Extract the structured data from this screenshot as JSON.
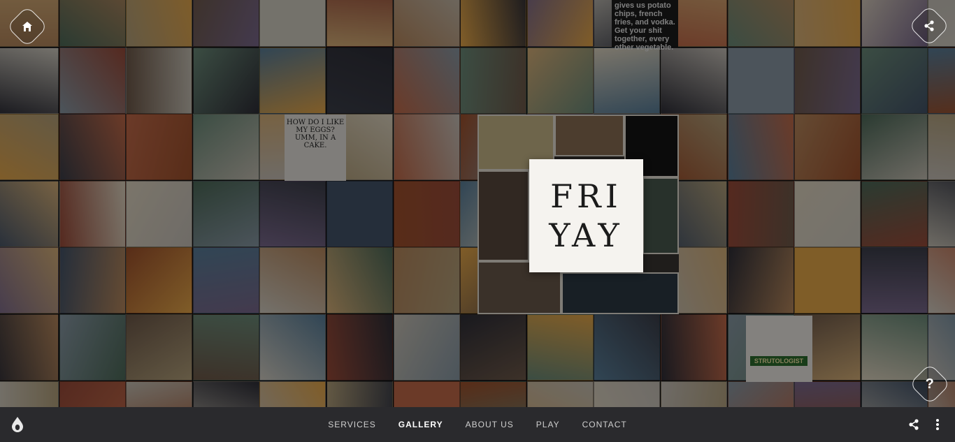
{
  "app": {
    "title": "Gallery"
  },
  "collage": {
    "feature_line1": "FRI",
    "feature_line2": "YAY",
    "tile_quote": "gives us potato chips, french fries, and vodka. Get your shit together, every other vegetable.",
    "tile_eggs": "HOW DO I LIKE MY EGGS? UMM, IN A CAKE.",
    "tile_strut": "STRUTOLOGIST"
  },
  "nav": {
    "items": [
      {
        "label": "SERVICES",
        "active": false
      },
      {
        "label": "GALLERY",
        "active": true
      },
      {
        "label": "ABOUT US",
        "active": false
      },
      {
        "label": "PLAY",
        "active": false
      },
      {
        "label": "CONTACT",
        "active": false
      }
    ]
  },
  "corner": {
    "help_symbol": "?"
  },
  "icons": {
    "home": "home-icon",
    "share_top": "share-icon",
    "help": "help-icon",
    "logo": "drop-logo-icon",
    "share_footer": "share-icon",
    "more": "more-vertical-icon"
  },
  "colors": {
    "footer_bg": "#2a2a2d",
    "nav_text": "#cfcfcf",
    "nav_active": "#ffffff",
    "feature_bg": "#f5f3ef"
  }
}
